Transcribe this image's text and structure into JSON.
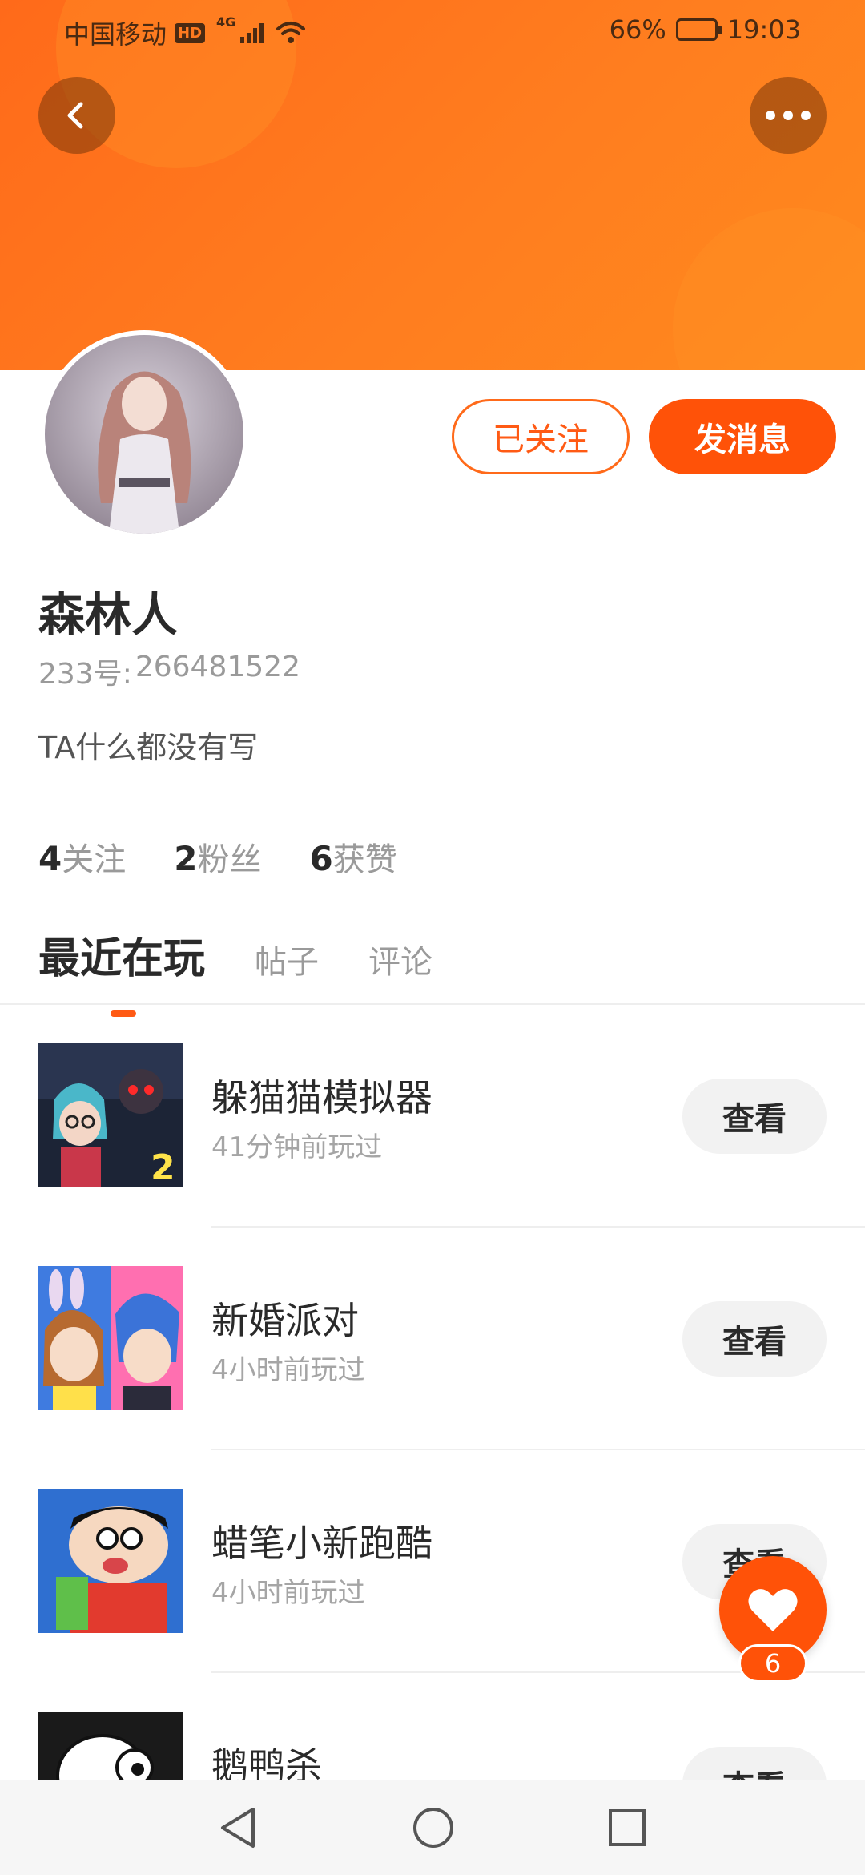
{
  "status_bar": {
    "carrier": "中国移动",
    "hd": "HD",
    "network": "4G",
    "battery": "66%",
    "battery_level": 0.66,
    "time": "19:03"
  },
  "header": {
    "back_icon": "chevron-left-icon",
    "more_icon": "more-horizontal-icon",
    "banner_color": "#ff7a1f"
  },
  "profile": {
    "follow_label": "已关注",
    "message_label": "发消息",
    "name": "森林人",
    "uid_label": "233号:",
    "uid_value": "266481522",
    "bio": "TA什么都没有写"
  },
  "stats": [
    {
      "num": "4",
      "label": "关注"
    },
    {
      "num": "2",
      "label": "粉丝"
    },
    {
      "num": "6",
      "label": "获赞"
    }
  ],
  "tabs": [
    {
      "label": "最近在玩",
      "active": true
    },
    {
      "label": "帖子",
      "active": false
    },
    {
      "label": "评论",
      "active": false
    }
  ],
  "games": [
    {
      "title": "躲猫猫模拟器",
      "time": "41分钟前玩过",
      "action": "查看"
    },
    {
      "title": "新婚派对",
      "time": "4小时前玩过",
      "action": "查看"
    },
    {
      "title": "蜡笔小新跑酷",
      "time": "4小时前玩过",
      "action": "查看"
    },
    {
      "title": "鹅鸭杀",
      "time": "",
      "action": "查看"
    }
  ],
  "like": {
    "icon": "heart-icon",
    "count": "6"
  },
  "colors": {
    "accent": "#ff5208",
    "muted_text": "#9a9a9a"
  }
}
